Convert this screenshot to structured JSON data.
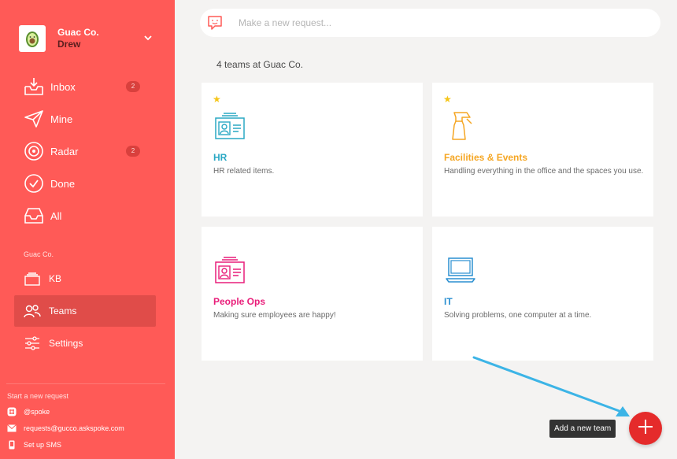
{
  "org": {
    "name": "Guac Co.",
    "user": "Drew"
  },
  "nav": [
    {
      "label": "Inbox",
      "badge": "2",
      "icon": "inbox-icon"
    },
    {
      "label": "Mine",
      "icon": "paper-plane-icon"
    },
    {
      "label": "Radar",
      "badge": "2",
      "icon": "radar-icon"
    },
    {
      "label": "Done",
      "icon": "check-circle-icon"
    },
    {
      "label": "All",
      "icon": "tray-icon"
    }
  ],
  "section_label": "Guac Co.",
  "section_nav": [
    {
      "label": "KB",
      "icon": "layers-icon"
    },
    {
      "label": "Teams",
      "icon": "people-icon"
    },
    {
      "label": "Settings",
      "icon": "sliders-icon"
    }
  ],
  "start_request": {
    "label": "Start a new request",
    "items": [
      {
        "label": "@spoke",
        "icon": "slack-icon"
      },
      {
        "label": "requests@gucco.askspoke.com",
        "icon": "envelope-icon"
      },
      {
        "label": "Set up SMS",
        "icon": "phone-icon"
      }
    ]
  },
  "search": {
    "placeholder": "Make a new request..."
  },
  "teams_count": "4 teams at Guac Co.",
  "teams": [
    {
      "name": "HR",
      "description": "HR related items.",
      "starred": true,
      "color": "#2aa8c4",
      "icon": "id-card-icon"
    },
    {
      "name": "Facilities & Events",
      "description": "Handling everything in the office and the spaces you use.",
      "starred": true,
      "color": "#f5a623",
      "icon": "spray-bottle-icon"
    },
    {
      "name": "People Ops",
      "description": "Making sure employees are happy!",
      "starred": false,
      "color": "#e91e7a",
      "icon": "id-card-icon"
    },
    {
      "name": "IT",
      "description": "Solving problems, one computer at a time.",
      "starred": false,
      "color": "#2a8fd1",
      "icon": "laptop-icon"
    }
  ],
  "fab": {
    "tooltip": "Add a new team"
  },
  "colors": {
    "sidebar": "#ff5a57",
    "fab": "#e52b2b",
    "arrow": "#3cb4e6"
  }
}
